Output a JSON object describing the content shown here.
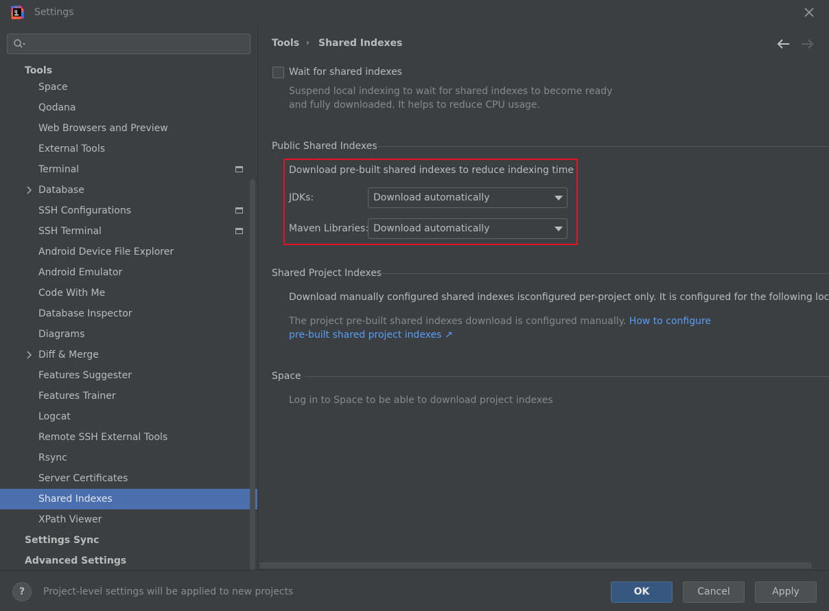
{
  "window": {
    "title": "Settings"
  },
  "search": {
    "placeholder": ""
  },
  "sidebar": {
    "group_tools": "Tools",
    "items": [
      {
        "label": "Space"
      },
      {
        "label": "Qodana"
      },
      {
        "label": "Web Browsers and Preview"
      },
      {
        "label": "External Tools"
      },
      {
        "label": "Terminal"
      },
      {
        "label": "Database"
      },
      {
        "label": "SSH Configurations"
      },
      {
        "label": "SSH Terminal"
      },
      {
        "label": "Android Device File Explorer"
      },
      {
        "label": "Android Emulator"
      },
      {
        "label": "Code With Me"
      },
      {
        "label": "Database Inspector"
      },
      {
        "label": "Diagrams"
      },
      {
        "label": "Diff & Merge"
      },
      {
        "label": "Features Suggester"
      },
      {
        "label": "Features Trainer"
      },
      {
        "label": "Logcat"
      },
      {
        "label": "Remote SSH External Tools"
      },
      {
        "label": "Rsync"
      },
      {
        "label": "Server Certificates"
      },
      {
        "label": "Shared Indexes"
      },
      {
        "label": "XPath Viewer"
      }
    ],
    "group_settings_sync": "Settings Sync",
    "group_advanced": "Advanced Settings"
  },
  "breadcrumb": {
    "parent": "Tools",
    "current": "Shared Indexes"
  },
  "wait": {
    "label": "Wait for shared indexes",
    "desc_line1": "Suspend local indexing to wait for shared indexes to become ready",
    "desc_line2": "and fully downloaded. It helps to reduce CPU usage.",
    "checked": false
  },
  "public": {
    "title": "Public Shared Indexes",
    "intro": "Download pre-built shared indexes to reduce indexing time",
    "jdks_label": "JDKs:",
    "jdks_value": "Download automatically",
    "maven_label": "Maven Libraries:",
    "maven_value": "Download automatically"
  },
  "project": {
    "title": "Shared Project Indexes",
    "desc": "Download manually configured shared indexes isconfigured per-project only. It is configured for the following location",
    "note": "The project pre-built shared indexes download is configured manually.",
    "link1": "How to configure",
    "link2": "pre-built shared project indexes ↗"
  },
  "space": {
    "title": "Space",
    "desc": "Log in to Space to be able to download project indexes"
  },
  "footer": {
    "help": "?",
    "status": "Project-level settings will be applied to new projects",
    "ok": "OK",
    "cancel": "Cancel",
    "apply": "Apply"
  },
  "colors": {
    "selection": "#4b6eaf",
    "highlight_border": "#e81123",
    "link": "#589df6"
  }
}
